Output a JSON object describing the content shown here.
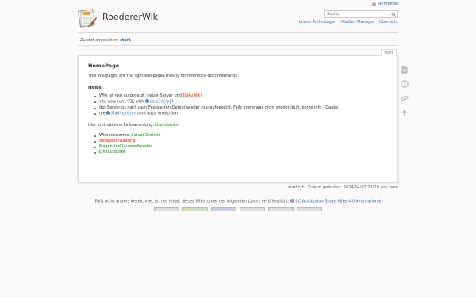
{
  "header": {
    "title": "RoedererWiki",
    "login_label": "Anmelden",
    "search_placeholder": "Suche",
    "links": [
      "Letzte Änderungen",
      "Medien-Manager",
      "Übersicht"
    ]
  },
  "breadcrumb": {
    "label": "Zuletzt angesehen:",
    "current": "start"
  },
  "page": {
    "tab": "start",
    "title": "HomePage",
    "intro": "This Wikipages are the light webpages mostly for reference-documentation.",
    "news_heading": "News",
    "news": [
      {
        "text": "Wiki ist neu aufgesetzt: neuer Server und ",
        "link": "DokuWiki"
      },
      {
        "text": "site now runs SSL with ",
        "link": "LetsEncrypt"
      },
      {
        "text": "der Server ist nach dem Festplatten-Defekt wieder neu aufgesetzt. Falls irgendwas nicht wieder läuft, kurze info - Danke",
        "link": ""
      },
      {
        "text": "die ",
        "link": "Mailinglisten",
        "after": " sind auch erreichbar"
      }
    ],
    "links_intro": "Hier erstmal eine Linksammlung: ",
    "links_intro_link": "UsefulLinks",
    "links_intro_end": ".",
    "links": [
      {
        "prefix": "Wissenswertes: ",
        "label": "Server-Dienste"
      },
      {
        "prefix": "",
        "label": "AblageVerwaltung"
      },
      {
        "prefix": "",
        "label": "MagenUndGaumenfreuden"
      },
      {
        "prefix": "",
        "label": "EinkaufsListe"
      }
    ]
  },
  "footer": {
    "pageinfo": "start.txt · Zuletzt geändert: 2024/04/07 21:20 von sven",
    "license_text": "Falls nicht anders bezeichnet, ist der Inhalt dieses Wikis unter der folgenden Lizenz veröffentlicht: ",
    "license_link": "CC Attribution-Share Alike 4.0 International"
  },
  "colors": {
    "link": "#2b73b7",
    "missing_link": "#dd3300",
    "interwiki": "#008800"
  },
  "icons": [
    "logo-icon",
    "user-icon",
    "search-icon",
    "page-icon",
    "revisions-icon",
    "backlinks-icon",
    "top-icon"
  ]
}
